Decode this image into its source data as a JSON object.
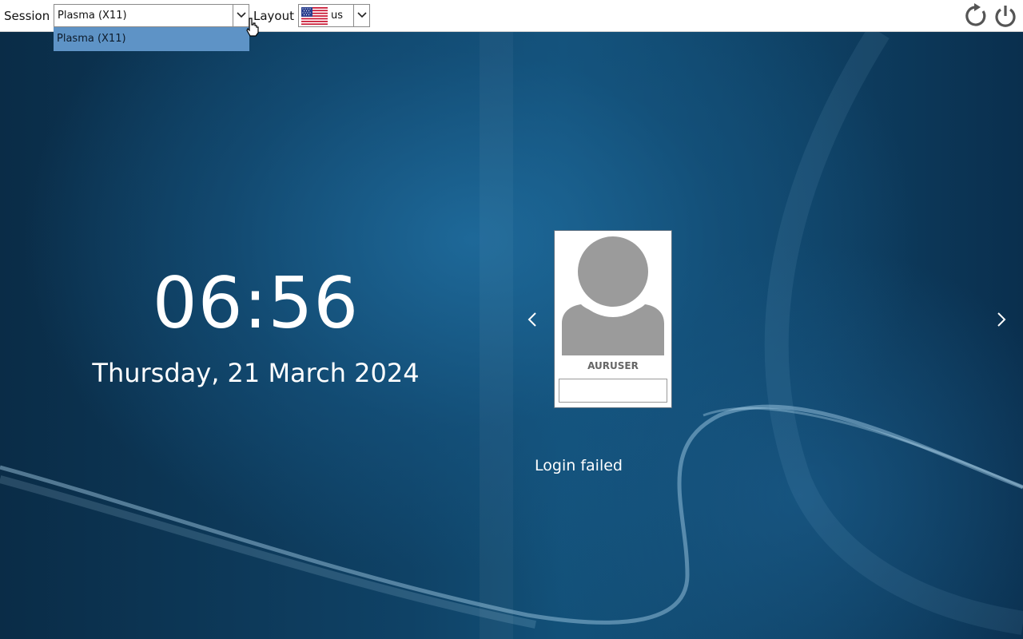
{
  "topbar": {
    "session_label": "Session",
    "session_value": "Plasma (X11)",
    "session_options": [
      "Plasma (X11)"
    ],
    "layout_label": "Layout",
    "layout_value": "us",
    "layout_flag_icon": "us-flag-icon",
    "reboot_icon": "reboot-icon",
    "shutdown_icon": "power-icon"
  },
  "clock": {
    "time": "06:56",
    "date": "Thursday, 21 March 2024"
  },
  "user": {
    "name": "AURUSER",
    "password_value": "",
    "prev_icon": "chevron-left-icon",
    "next_icon": "chevron-right-icon"
  },
  "status": {
    "message": "Login failed"
  },
  "colors": {
    "dropdown_highlight": "#5e93c6",
    "background": "#0f3f60",
    "text_on_bg": "#ffffff"
  }
}
